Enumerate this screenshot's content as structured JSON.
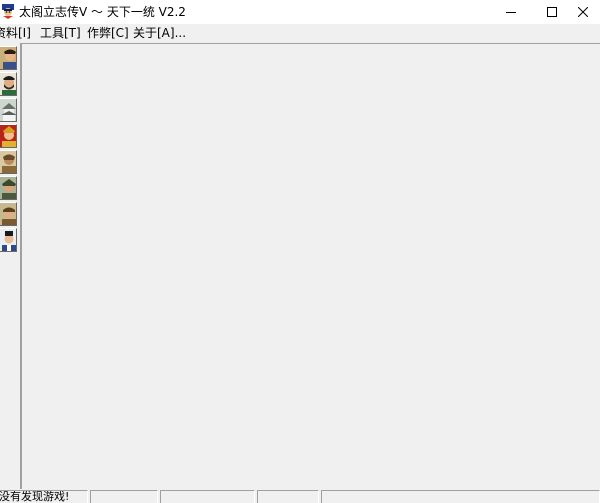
{
  "window": {
    "title": "太阁立志传V ～ 天下一统 V2.2",
    "icon": "app-character-icon"
  },
  "menu": [
    {
      "label": "资料[I]"
    },
    {
      "label": "工具[T]"
    },
    {
      "label": "作弊[C]"
    },
    {
      "label": "关于[A]..."
    }
  ],
  "toolbar": {
    "buttons": [
      {
        "icon": "portrait-man-icon"
      },
      {
        "icon": "portrait-bearded-man-icon"
      },
      {
        "icon": "castle-icon"
      },
      {
        "icon": "lord-portrait-icon"
      },
      {
        "icon": "ninja-portrait-icon"
      },
      {
        "icon": "warrior-portrait-icon"
      },
      {
        "icon": "monk-portrait-icon"
      },
      {
        "icon": "scholar-portrait-icon"
      }
    ]
  },
  "statusbar": {
    "panels": [
      {
        "text": "没有发现游戏!"
      },
      {
        "text": ""
      },
      {
        "text": ""
      },
      {
        "text": ""
      },
      {
        "text": ""
      },
      {
        "text": ""
      }
    ]
  },
  "colors": {
    "titlebar_bg": "#ffffff",
    "window_bg": "#f0f0f0",
    "border_dark": "#a0a0a0"
  }
}
